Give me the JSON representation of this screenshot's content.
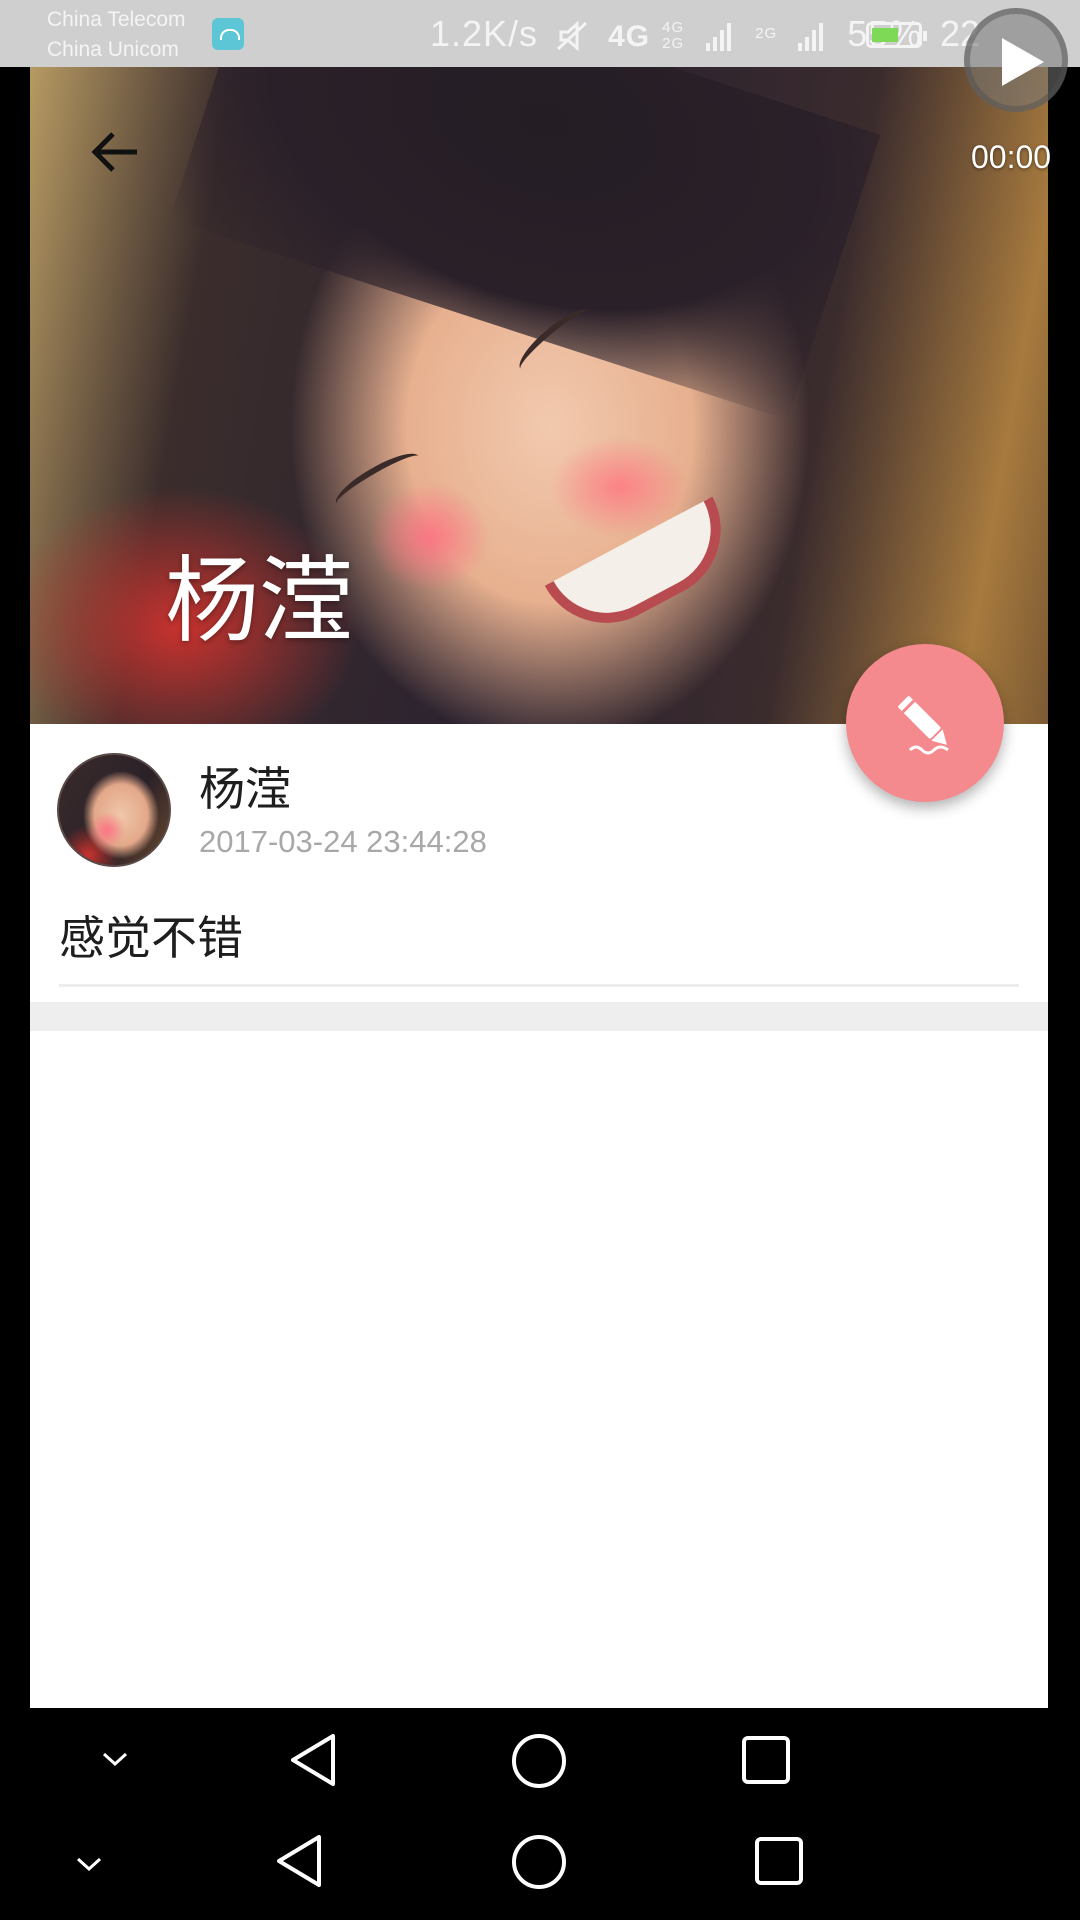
{
  "status_bar": {
    "carrier_1": "China Telecom",
    "carrier_2": "China Unicom",
    "net_speed": "1.2K/s",
    "network_1": "4G",
    "network_2_top": "4G",
    "network_2_bottom": "2G",
    "network_3": "2G",
    "battery_percent": "55%",
    "clock_partial": "22"
  },
  "header": {
    "title": "杨滢"
  },
  "post": {
    "author_name": "杨滢",
    "timestamp": "2017-03-24 23:44:28",
    "content": "感觉不错"
  },
  "recorder": {
    "timer": "00:00"
  },
  "icons": {
    "back": "arrow-left-icon",
    "edit": "pencil-icon",
    "play": "play-icon",
    "nav_collapse": "chevron-down-icon",
    "nav_back": "triangle-back-icon",
    "nav_home": "circle-home-icon",
    "nav_recent": "square-recent-icon"
  },
  "colors": {
    "fab": "#f58a8e",
    "status_bar_bg": "#cfcfcf",
    "divider": "#ededed",
    "timestamp_text": "#a8a8a8"
  }
}
